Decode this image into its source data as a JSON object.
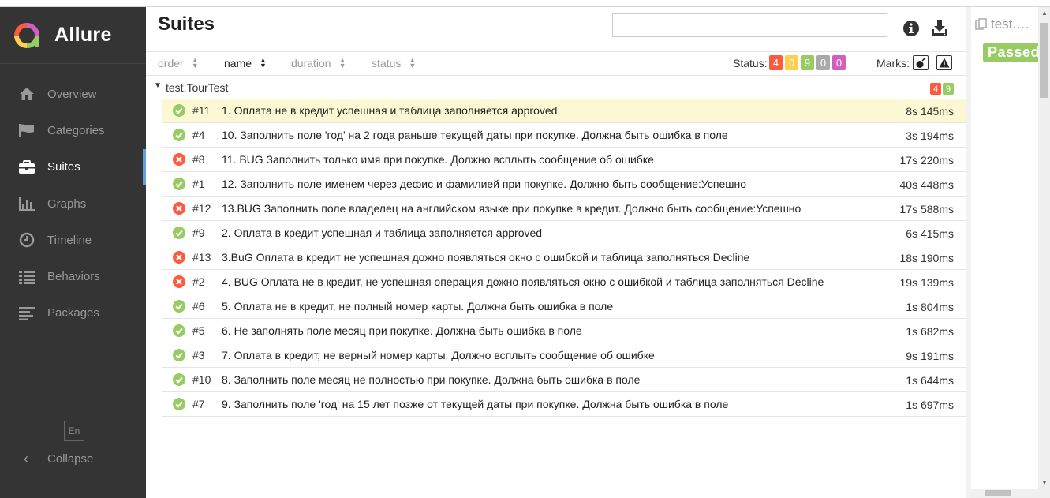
{
  "app": {
    "name": "Allure",
    "lang": "En",
    "collapse_label": "Collapse"
  },
  "sidebar": {
    "items": [
      {
        "label": "Overview",
        "icon": "home-icon"
      },
      {
        "label": "Categories",
        "icon": "flag-icon"
      },
      {
        "label": "Suites",
        "icon": "briefcase-icon",
        "active": true
      },
      {
        "label": "Graphs",
        "icon": "bar-chart-icon"
      },
      {
        "label": "Timeline",
        "icon": "clock-icon"
      },
      {
        "label": "Behaviors",
        "icon": "list-icon"
      },
      {
        "label": "Packages",
        "icon": "align-left-icon"
      }
    ]
  },
  "main": {
    "title": "Suites",
    "search_value": "",
    "sort": {
      "order": "order",
      "name": "name",
      "duration": "duration",
      "status": "status"
    },
    "status_label": "Status:",
    "status_counts": [
      {
        "value": "4",
        "color": "#fd5a3e"
      },
      {
        "value": "0",
        "color": "#ffd050"
      },
      {
        "value": "9",
        "color": "#97cc64"
      },
      {
        "value": "0",
        "color": "#aaaaaa"
      },
      {
        "value": "0",
        "color": "#d35ebe"
      }
    ],
    "marks_label": "Marks:",
    "group": {
      "name": "test.TourTest",
      "failed": "4",
      "passed": "9"
    },
    "rows": [
      {
        "status": "passed",
        "num": "#11",
        "title": "1. Оплата не в кредит успешная и таблица заполняется approved",
        "duration": "8s 145ms",
        "highlight": true
      },
      {
        "status": "passed",
        "num": "#4",
        "title": "10. Заполнить поле 'год' на 2 года раньше текущей даты при покупке. Должна быть ошибка в поле",
        "duration": "3s 194ms"
      },
      {
        "status": "failed",
        "num": "#8",
        "title": "11. BUG Заполнить только имя при покупке. Должно всплыть сообщение об ошибке",
        "duration": "17s 220ms"
      },
      {
        "status": "passed",
        "num": "#1",
        "title": "12. Заполнить поле именем через дефис и фамилией при покупке. Должно быть сообщение:Успешно",
        "duration": "40s 448ms"
      },
      {
        "status": "failed",
        "num": "#12",
        "title": "13.BUG Заполнить поле владелец на английском языке при покупке в кредит. Должно быть сообщение:Успешно",
        "duration": "17s 588ms"
      },
      {
        "status": "passed",
        "num": "#9",
        "title": "2. Оплата в кредит успешная и таблица заполняется approved",
        "duration": "6s 415ms"
      },
      {
        "status": "failed",
        "num": "#13",
        "title": "3.BuG Оплата в кредит не успешная дожно появляться окно с ошибкой и таблица заполняться Decline",
        "duration": "18s 190ms"
      },
      {
        "status": "failed",
        "num": "#2",
        "title": "4. BUG Оплата не в кредит, не успешная операция дожно появляться окно с ошибкой и таблица заполняться Decline",
        "duration": "19s 139ms"
      },
      {
        "status": "passed",
        "num": "#6",
        "title": "5. Оплата не в кредит, не полный номер карты. Должна быть ошибка в поле",
        "duration": "1s 804ms"
      },
      {
        "status": "passed",
        "num": "#5",
        "title": "6. Не заполнять поле месяц при покупке. Должна быть ошибка в поле",
        "duration": "1s 682ms"
      },
      {
        "status": "passed",
        "num": "#3",
        "title": "7. Оплата в кредит, не верный номер карты. Должно всплыть сообщение об ошибке",
        "duration": "9s 191ms"
      },
      {
        "status": "passed",
        "num": "#10",
        "title": "8. Заполнить поле месяц не полностью при покупке. Должна быть ошибка в поле",
        "duration": "1s 644ms"
      },
      {
        "status": "passed",
        "num": "#7",
        "title": "9. Заполнить поле 'год' на 15 лет позже от текущей даты при покупке. Должна быть ошибка в поле",
        "duration": "1s 697ms"
      }
    ]
  },
  "details": {
    "title": "test.…",
    "status": "Passed"
  },
  "colors": {
    "passed": "#97cc64",
    "failed": "#fd5a3e",
    "sidebar_bg": "#343434",
    "accent": "#61a0e0",
    "highlight": "#fcf8d4"
  }
}
